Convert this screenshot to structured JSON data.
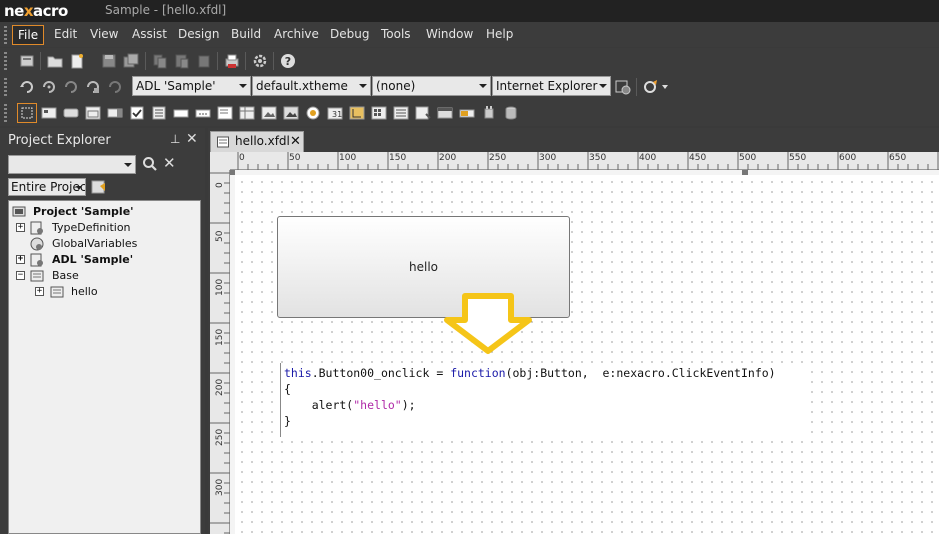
{
  "window": {
    "logo_left": "ne",
    "logo_x": "x",
    "logo_right": "acro",
    "title": "Sample - [hello.xfdl]"
  },
  "menu": [
    "File",
    "Edit",
    "View",
    "Assist",
    "Design",
    "Build",
    "Archive",
    "Debug",
    "Tools",
    "Window",
    "Help"
  ],
  "toolbar_combos": {
    "adl": "ADL 'Sample'",
    "theme": "default.xtheme",
    "none": "(none)",
    "browser": "Internet Explorer"
  },
  "explorer": {
    "title": "Project Explorer",
    "filter": "Entire Project",
    "tree": [
      {
        "label": "Project 'Sample'",
        "bold": true
      },
      {
        "label": "TypeDefinition",
        "bold": false
      },
      {
        "label": "GlobalVariables",
        "bold": false
      },
      {
        "label": "ADL 'Sample'",
        "bold": true
      },
      {
        "label": "Base",
        "bold": false
      },
      {
        "label": "hello",
        "bold": false
      }
    ]
  },
  "document": {
    "tab_label": "hello.xfdl",
    "ruler_h": [
      "0",
      "50",
      "100",
      "150",
      "200",
      "250",
      "300",
      "350",
      "400",
      "450",
      "500",
      "550",
      "600",
      "650"
    ],
    "ruler_v": [
      "0",
      "50",
      "100",
      "150",
      "200",
      "250",
      "300"
    ],
    "button_text": "hello"
  },
  "code": {
    "line1_this": "this",
    "line1_mid": ".Button00_onclick = ",
    "line1_function": "function",
    "line1_end": "(obj:Button,  e:nexacro.ClickEventInfo)",
    "line2": "{",
    "line3_start": "    alert(",
    "line3_string": "\"hello\"",
    "line3_end": ");",
    "line4": "}"
  },
  "colors": {
    "accent": "#e08a2a",
    "arrow": "#f5c518",
    "keyword": "#1a1aa8",
    "string": "#b02aa8"
  }
}
